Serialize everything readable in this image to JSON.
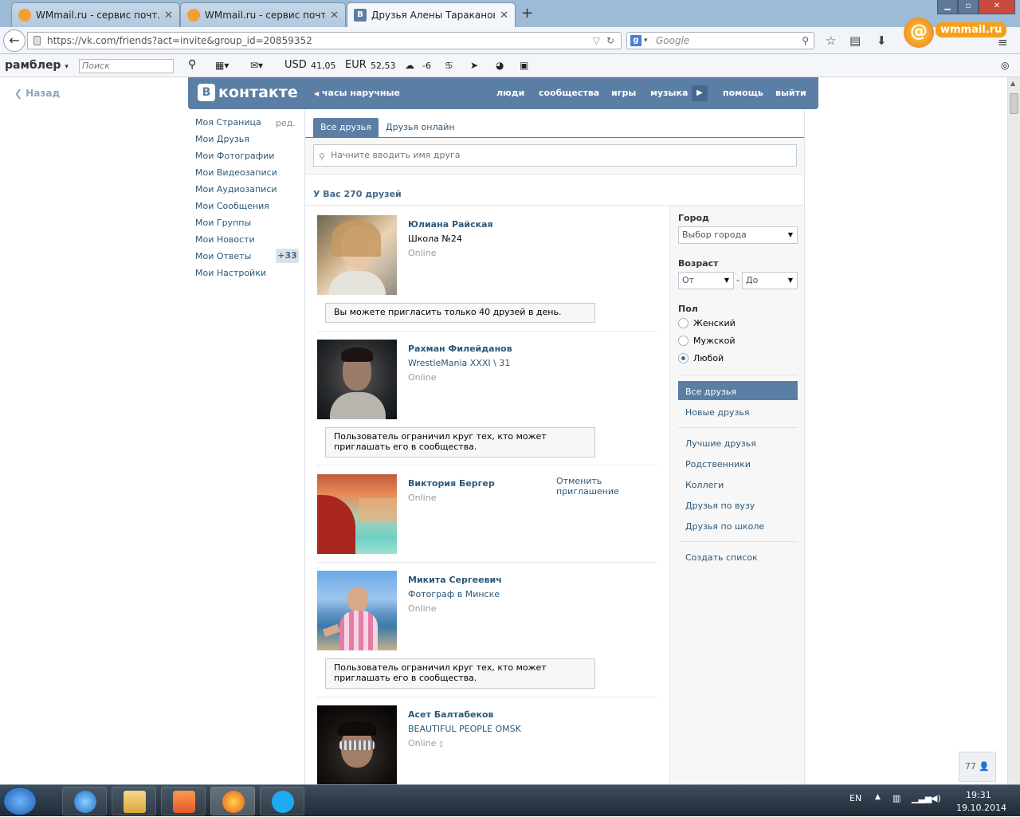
{
  "browser": {
    "tabs": [
      {
        "title": "WMmail.ru - сервис почт...",
        "active": false,
        "icon": "wmmail-icon"
      },
      {
        "title": "WMmail.ru - сервис почт...",
        "active": false,
        "icon": "wmmail-icon"
      },
      {
        "title": "Друзья Алены Тараканов...",
        "active": true,
        "icon": "vk-icon"
      }
    ],
    "new_tab": "+",
    "url": "https://vk.com/friends?act=invite&group_id=20859352",
    "search_engine": "g",
    "search_placeholder": "Google",
    "logo_text": "wmmail.ru",
    "logo_glyph": "@"
  },
  "rambler": {
    "logo": "рамблер",
    "search_placeholder": "Поиск",
    "usd_label": "USD",
    "usd_value": "41,05",
    "eur_label": "EUR",
    "eur_value": "52,53",
    "weather": "-6"
  },
  "page": {
    "back": "Назад",
    "brand": "контакте",
    "brand_letter": "В",
    "status": "часы наручные",
    "nav": [
      "люди",
      "сообщества",
      "игры",
      "музыка",
      "помощь",
      "выйти"
    ],
    "left_menu": [
      "Моя Страница",
      "Мои Друзья",
      "Мои Фотографии",
      "Мои Видеозаписи",
      "Мои Аудиозаписи",
      "Мои Сообщения",
      "Мои Группы",
      "Мои Новости",
      "Мои Ответы",
      "Мои Настройки"
    ],
    "edit_label": "ред.",
    "answers_badge": "+33",
    "tabs": [
      "Все друзья",
      "Друзья онлайн"
    ],
    "search_placeholder": "Начните вводить имя друга",
    "count_text": "У Вас 270 друзей",
    "counter": "77"
  },
  "friends": [
    {
      "name": "Юлиана Райская",
      "sub": "Школа №24",
      "online": "Online",
      "note": "Вы можете пригласить только 40 друзей в день."
    },
    {
      "name": "Рахман Филейданов",
      "sub": "WrestleMania XXXI \\ 31",
      "online": "Online",
      "note": "Пользователь ограничил круг тех, кто может приглашать его в сообщества."
    },
    {
      "name": "Виктория Бергер",
      "sub": "",
      "online": "Online",
      "cancel": "Отменить приглашение"
    },
    {
      "name": "Микита Сергеевич",
      "sub": "Фотограф в Минске",
      "online": "Online",
      "note": "Пользователь ограничил круг тех, кто может приглашать его в сообщества."
    },
    {
      "name": "Асет Балтабеков",
      "sub": "BEAUTIFUL PEOPLE OMSK",
      "online": "Online"
    }
  ],
  "filters": {
    "city_label": "Город",
    "city_value": "Выбор города",
    "age_label": "Возраст",
    "age_from": "От",
    "age_to": "До",
    "age_dash": "-",
    "gender_label": "Пол",
    "genders": [
      "Женский",
      "Мужской",
      "Любой"
    ],
    "lists": [
      "Все друзья",
      "Новые друзья",
      "Лучшие друзья",
      "Родственники",
      "Коллеги",
      "Друзья по вузу",
      "Друзья по школе",
      "Создать список"
    ]
  },
  "taskbar": {
    "lang": "EN",
    "time": "19:31",
    "date": "19.10.2014"
  },
  "colors": {
    "vk_blue": "#5b7ea4",
    "link": "#2b587a",
    "tabbar": "#9dbad6"
  }
}
